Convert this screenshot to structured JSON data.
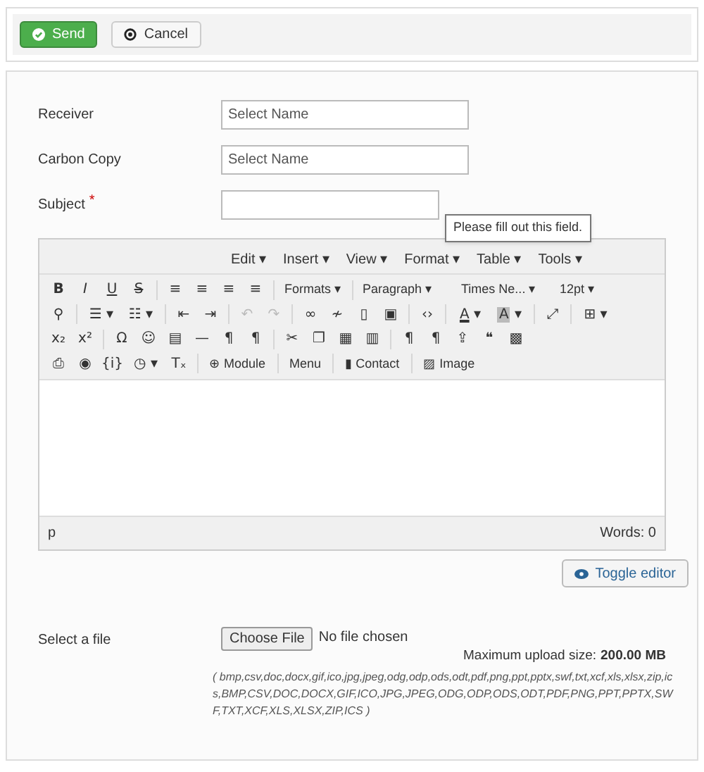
{
  "toolbar_buttons": [
    {
      "kind": "send",
      "label": "Send"
    },
    {
      "kind": "cancel",
      "label": "Cancel"
    }
  ],
  "fields": [
    {
      "label": "Receiver",
      "placeholder": "Select Name"
    },
    {
      "label": "Carbon Copy",
      "placeholder": "Select Name"
    },
    {
      "label": "Subject",
      "required_mark": "*"
    }
  ],
  "tooltip": "Please fill out this field.",
  "editor": {
    "menu": [
      "Edit",
      "Insert",
      "View",
      "Format",
      "Table",
      "Tools"
    ],
    "menu_caret": "▾",
    "toolbar_lines": [
      {
        "buttons": [
          {
            "glyph": "B"
          },
          {
            "glyph": "I"
          },
          {
            "glyph": "U"
          },
          {
            "glyph": "S"
          },
          {
            "kind": "sep"
          },
          {
            "glyph": "≡"
          },
          {
            "glyph": "≡"
          },
          {
            "glyph": "≡"
          },
          {
            "glyph": "≡"
          },
          {
            "kind": "sep"
          },
          {
            "kind": "dropdown",
            "label": "Formats"
          },
          {
            "kind": "sep"
          },
          {
            "kind": "select",
            "label": "Paragraph"
          },
          {
            "kind": "select",
            "label": "Times Ne..."
          },
          {
            "kind": "select",
            "label": "12pt"
          }
        ]
      },
      {
        "buttons": [
          {
            "glyph": "⚲"
          },
          {
            "kind": "sep"
          },
          {
            "kind": "split",
            "glyph": "☰"
          },
          {
            "kind": "split",
            "glyph": "☷"
          },
          {
            "kind": "sep"
          },
          {
            "glyph": "⇤"
          },
          {
            "glyph": "⇥"
          },
          {
            "kind": "sep"
          },
          {
            "glyph": "↶",
            "disabled": true
          },
          {
            "glyph": "↷",
            "disabled": true
          },
          {
            "kind": "sep"
          },
          {
            "glyph": "∞"
          },
          {
            "glyph": "≁"
          },
          {
            "glyph": "▯"
          },
          {
            "glyph": "▣"
          },
          {
            "kind": "sep"
          },
          {
            "glyph": "‹›"
          },
          {
            "kind": "sep"
          },
          {
            "kind": "split",
            "glyph": "A"
          },
          {
            "kind": "split",
            "glyph": "A"
          },
          {
            "kind": "sep"
          },
          {
            "glyph": "⤢"
          },
          {
            "kind": "sep"
          },
          {
            "kind": "split",
            "glyph": "⊞"
          }
        ]
      },
      {
        "buttons": [
          {
            "glyph": "x₂"
          },
          {
            "glyph": "x²"
          },
          {
            "kind": "sep"
          },
          {
            "glyph": "Ω"
          },
          {
            "glyph": "☺"
          },
          {
            "glyph": "▤"
          },
          {
            "glyph": "—"
          },
          {
            "glyph": "¶"
          },
          {
            "glyph": "¶"
          },
          {
            "kind": "sep"
          },
          {
            "glyph": "✂"
          },
          {
            "glyph": "❐"
          },
          {
            "glyph": "▦"
          },
          {
            "glyph": "▥"
          },
          {
            "kind": "sep"
          },
          {
            "glyph": "¶"
          },
          {
            "glyph": "¶"
          },
          {
            "glyph": "⇪"
          },
          {
            "glyph": "❝"
          },
          {
            "glyph": "▩"
          }
        ]
      },
      {
        "buttons": [
          {
            "glyph": "⎙"
          },
          {
            "glyph": "◉"
          },
          {
            "glyph": "{i}"
          },
          {
            "kind": "split",
            "glyph": "◷"
          },
          {
            "glyph": "Tₓ"
          },
          {
            "kind": "sep"
          },
          {
            "kind": "text",
            "glyph": "⊕",
            "label": "Module"
          },
          {
            "kind": "sep"
          },
          {
            "kind": "text",
            "label": "Menu"
          },
          {
            "kind": "sep"
          },
          {
            "kind": "text",
            "glyph": "▮",
            "label": "Contact"
          },
          {
            "kind": "sep"
          },
          {
            "kind": "text",
            "glyph": "▨",
            "label": "Image"
          }
        ]
      }
    ],
    "caret": "▾",
    "path": "p",
    "word_count": "Words: 0"
  },
  "toggle_editor": "Toggle editor",
  "file": {
    "label": "Select a file",
    "button": "Choose File",
    "status": "No file chosen",
    "max_label": "Maximum upload size:",
    "max_value": "200.00 MB",
    "extensions": "( bmp,csv,doc,docx,gif,ico,jpg,jpeg,odg,odp,ods,odt,pdf,png,ppt,pptx,swf,txt,xcf,xls,xlsx,zip,ics,BMP,CSV,DOC,DOCX,GIF,ICO,JPG,JPEG,ODG,ODP,ODS,ODT,PDF,PNG,PPT,PPTX,SWF,TXT,XCF,XLS,XLSX,ZIP,ICS )"
  }
}
